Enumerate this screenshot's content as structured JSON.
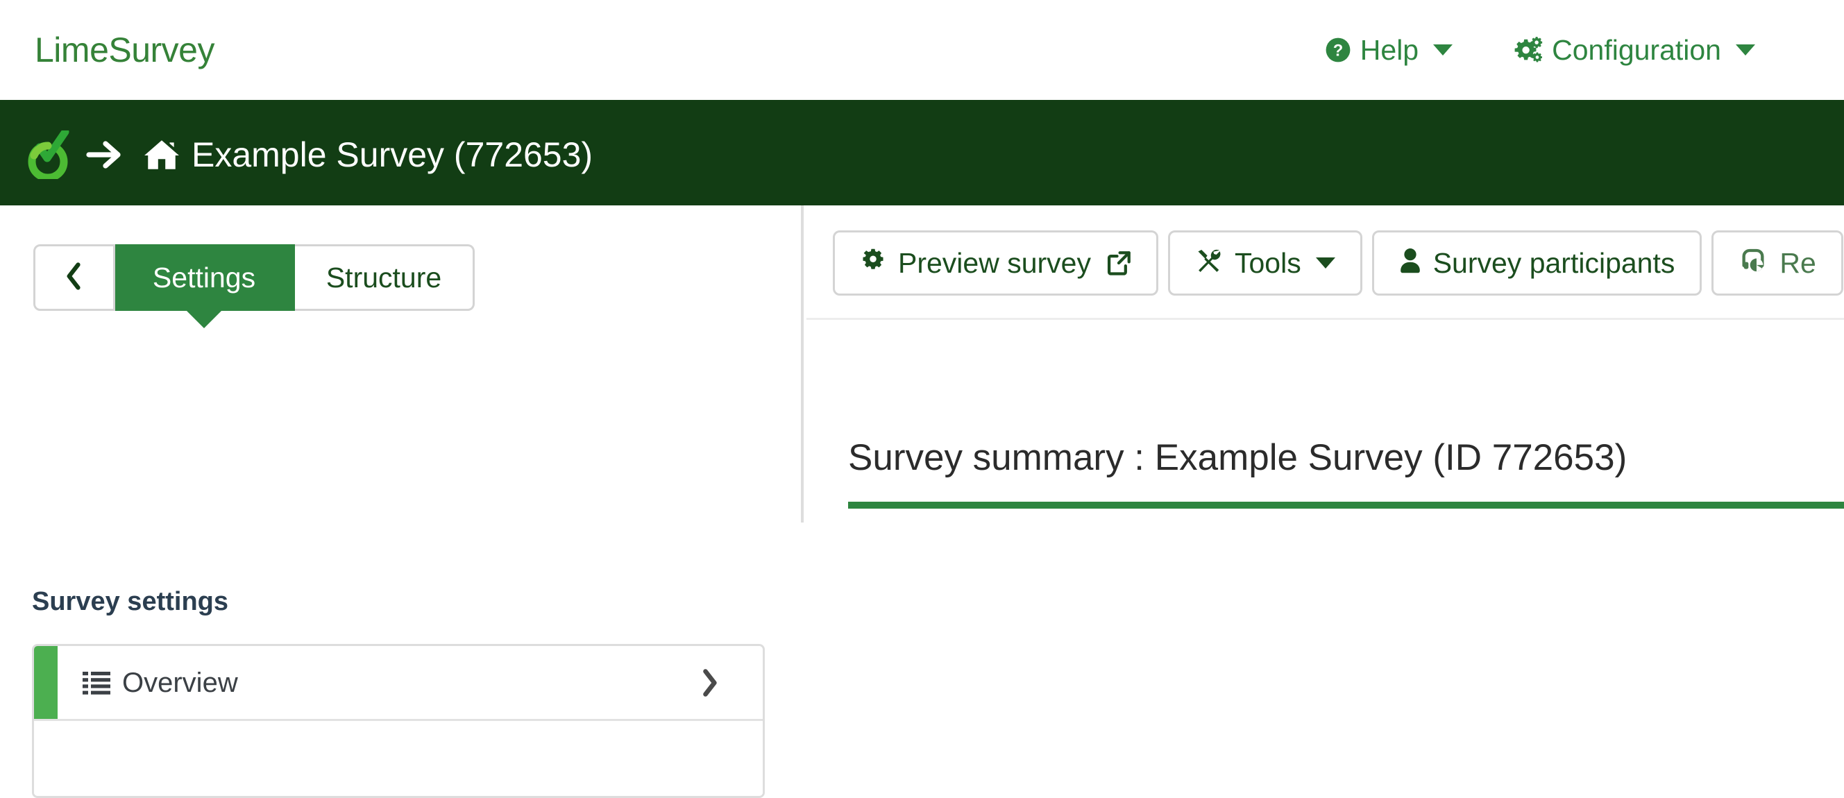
{
  "topbar": {
    "brand": "LimeSurvey",
    "nav": [
      {
        "label": "Help",
        "icon": "question-circle-icon",
        "caret": true
      },
      {
        "label": "Configuration",
        "icon": "cogs-icon",
        "caret": true
      }
    ]
  },
  "surveybar": {
    "logo_icon": "limesurvey-logo-icon",
    "arrow_icon": "arrow-right-icon",
    "home_icon": "home-icon",
    "title": "Example Survey (772653)"
  },
  "sidebar": {
    "collapse_icon": "chevron-left-icon",
    "tabs": [
      {
        "label": "Settings",
        "active": true
      },
      {
        "label": "Structure",
        "active": false
      }
    ],
    "heading": "Survey settings",
    "items": [
      {
        "label": "Overview",
        "icon": "list-ul-icon",
        "chevron": "chevron-right-icon",
        "active": true
      }
    ]
  },
  "main": {
    "toolbar": [
      {
        "label": "Preview survey",
        "icon": "gear-icon",
        "external": true
      },
      {
        "label": "Tools",
        "icon": "tools-icon",
        "caret": true
      },
      {
        "label": "Survey participants",
        "icon": "user-icon"
      },
      {
        "label": "Re",
        "icon": "responses-icon",
        "muted": true
      }
    ],
    "summary_title": "Survey summary : Example Survey (ID 772653)"
  },
  "colors": {
    "brand_green": "#358238",
    "dark_green": "#123D14",
    "accent_green": "#2E8540",
    "bright_green": "#4CAF50",
    "border_grey": "#D4D4D4"
  }
}
